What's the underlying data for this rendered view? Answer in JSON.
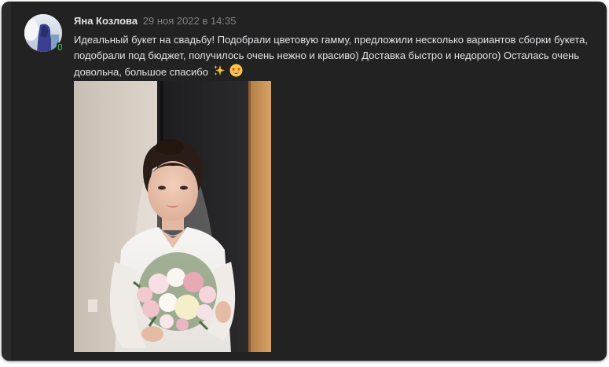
{
  "comment": {
    "author": "Яна Козлова",
    "date": "29 ноя 2022 в 14:35",
    "text": "Идеальный букет на свадьбу! Подобрали цветовую гамму, предложили несколько вариантов сборки букета, подобрали под бюджет, получилось очень нежно и красиво) Доставка быстро и недорого) Осталась очень довольна, большое спасибо",
    "emojis": [
      "sparkles-icon",
      "star-struck-face-icon"
    ],
    "online_status": "mobile",
    "photo_alt": "bride-with-bouquet-photo"
  },
  "colors": {
    "background": "#222222",
    "text": "#e1e3e6",
    "muted": "#828282",
    "online": "#4bb34b"
  }
}
